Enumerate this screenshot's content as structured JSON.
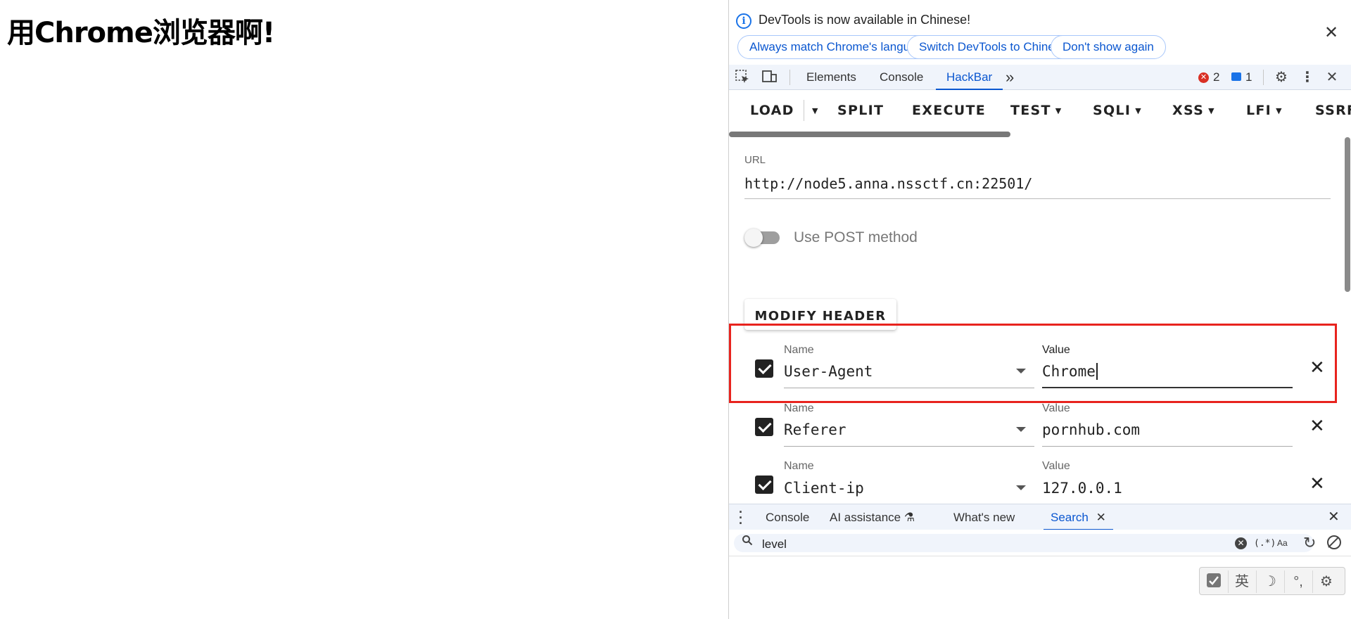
{
  "page": {
    "heading": "用Chrome浏览器啊!"
  },
  "infobar": {
    "message": "DevTools is now available in Chinese!",
    "buttons": [
      "Always match Chrome's language",
      "Switch DevTools to Chinese",
      "Don't show again"
    ],
    "close_icon": "close-icon"
  },
  "toolbar": {
    "tabs": [
      "Elements",
      "Console",
      "HackBar"
    ],
    "active_tab": "HackBar",
    "more": "»",
    "error_count": "2",
    "message_count": "1",
    "icons": [
      "inspect-element-icon",
      "device-toolbar-icon",
      "error-icon",
      "message-icon",
      "settings-icon",
      "kebab-menu-icon",
      "close-icon"
    ]
  },
  "hackbar": {
    "menu": [
      {
        "label": "LOAD",
        "has_caret": false
      },
      {
        "label": "SPLIT",
        "has_caret": false
      },
      {
        "label": "EXECUTE",
        "has_caret": false
      },
      {
        "label": "TEST",
        "has_caret": true
      },
      {
        "label": "SQLI",
        "has_caret": true
      },
      {
        "label": "XSS",
        "has_caret": true
      },
      {
        "label": "LFI",
        "has_caret": true
      },
      {
        "label": "SSRF",
        "has_caret": false
      }
    ],
    "url_label": "URL",
    "url_value": "http://node5.anna.nssctf.cn:22501/",
    "post_label": "Use POST method",
    "post_enabled": false,
    "modify_header_label": "MODIFY HEADER",
    "headers": [
      {
        "name_label": "Name",
        "name": "User-Agent",
        "value_label": "Value",
        "value": "Chrome",
        "checked": true,
        "focused": true
      },
      {
        "name_label": "Name",
        "name": "Referer",
        "value_label": "Value",
        "value": "pornhub.com",
        "checked": true,
        "focused": false
      },
      {
        "name_label": "Name",
        "name": "Client-ip",
        "value_label": "Value",
        "value": "127.0.0.1",
        "checked": true,
        "focused": false
      }
    ],
    "highlight_color": "#e8231e"
  },
  "drawer": {
    "tabs": [
      "Console",
      "AI assistance",
      "What's new",
      "Search"
    ],
    "active_tab": "Search",
    "search_value": "level",
    "regex_label": "(.*)",
    "case_label": "Aa"
  },
  "ime_toolbar": {
    "language": "英"
  },
  "colors": {
    "accent": "#0b57d0",
    "error": "#d93025",
    "toolbar_bg": "#f0f4fb"
  }
}
